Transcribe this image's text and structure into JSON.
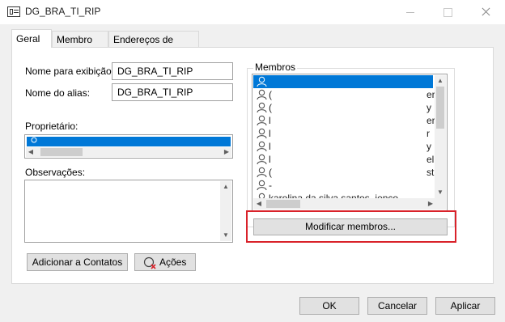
{
  "window": {
    "title": "DG_BRA_TI_RIP"
  },
  "tabs": [
    {
      "label": "Geral"
    },
    {
      "label": "Membro de"
    },
    {
      "label": "Endereços de email"
    }
  ],
  "form": {
    "display_name_label": "Nome para exibição:",
    "display_name_value": "DG_BRA_TI_RIP",
    "alias_label": "Nome do alias:",
    "alias_value": "DG_BRA_TI_RIP",
    "owner_label": "Proprietário:",
    "notes_label": "Observações:"
  },
  "members": {
    "group_label": "Membros",
    "rows": [
      {
        "name": "",
        "right": "",
        "selected": true
      },
      {
        "name": "(",
        "right": "er",
        "selected": false
      },
      {
        "name": "(",
        "right": "y",
        "selected": false
      },
      {
        "name": "l",
        "right": "er",
        "selected": false
      },
      {
        "name": "l",
        "right": "r",
        "selected": false
      },
      {
        "name": "l",
        "right": "y",
        "selected": false
      },
      {
        "name": "l",
        "right": "el",
        "selected": false
      },
      {
        "name": "(",
        "right": "st",
        "selected": false
      },
      {
        "name": "-",
        "right": "",
        "selected": false
      },
      {
        "name": "karolina da silva santos, jenco",
        "right": "",
        "selected": false
      }
    ],
    "modify_button": "Modificar membros..."
  },
  "buttons": {
    "add_contacts": "Adicionar a Contatos",
    "actions": "Ações",
    "ok": "OK",
    "cancel": "Cancelar",
    "apply": "Aplicar"
  },
  "colors": {
    "selection": "#0078d7",
    "highlight_border": "#d9222a"
  }
}
